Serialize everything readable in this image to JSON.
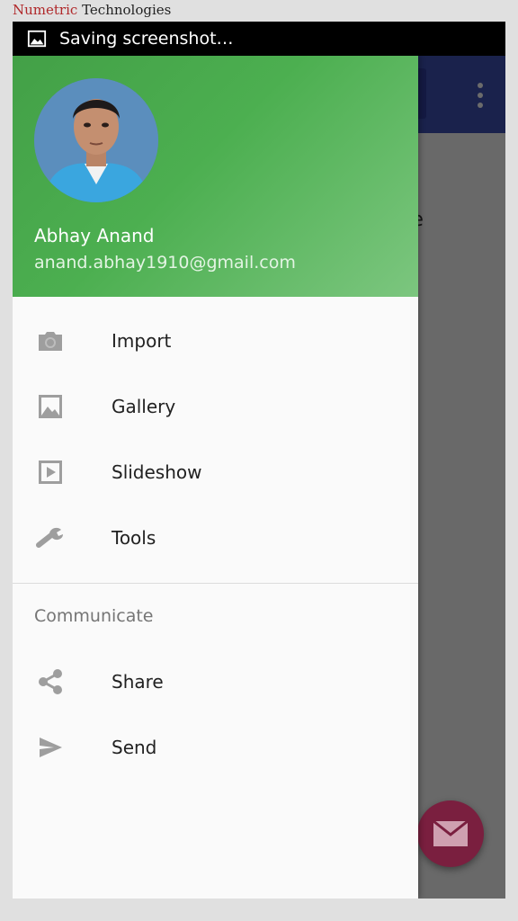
{
  "watermark": {
    "brand": "Numetric",
    "rest": "Technologies"
  },
  "status_bar": {
    "icon": "image-icon",
    "text": "Saving screenshot…"
  },
  "background_app": {
    "visible_text": "ofile",
    "fab_icon": "mail-icon",
    "toolbar_color": "#3f51b5",
    "fab_color": "#c2185b"
  },
  "drawer": {
    "header": {
      "name": "Abhay Anand",
      "email": "anand.abhay1910@gmail.com",
      "colors": {
        "start": "#43a047",
        "end": "#7cc67f"
      }
    },
    "items": [
      {
        "label": "Import",
        "icon": "camera-icon"
      },
      {
        "label": "Gallery",
        "icon": "photo-icon"
      },
      {
        "label": "Slideshow",
        "icon": "slideshow-icon"
      },
      {
        "label": "Tools",
        "icon": "wrench-icon"
      }
    ],
    "section": {
      "title": "Communicate",
      "items": [
        {
          "label": "Share",
          "icon": "share-icon"
        },
        {
          "label": "Send",
          "icon": "send-icon"
        }
      ]
    }
  }
}
